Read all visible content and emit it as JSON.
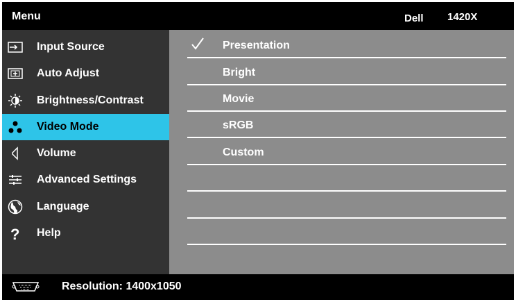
{
  "header": {
    "menu_title": "Menu",
    "brand": "Dell",
    "model": "1420X"
  },
  "sidebar": {
    "items": [
      {
        "label": "Input Source",
        "icon": "input-source-icon"
      },
      {
        "label": "Auto Adjust",
        "icon": "auto-adjust-icon"
      },
      {
        "label": "Brightness/Contrast",
        "icon": "brightness-icon"
      },
      {
        "label": "Video Mode",
        "icon": "video-mode-icon",
        "active": true
      },
      {
        "label": "Volume",
        "icon": "volume-icon"
      },
      {
        "label": "Advanced Settings",
        "icon": "advanced-settings-icon"
      },
      {
        "label": "Language",
        "icon": "globe-icon"
      },
      {
        "label": "Help",
        "icon": "help-icon"
      }
    ]
  },
  "video_modes": {
    "options": [
      {
        "label": "Presentation",
        "selected": true
      },
      {
        "label": "Bright"
      },
      {
        "label": "Movie"
      },
      {
        "label": "sRGB"
      },
      {
        "label": "Custom"
      },
      {
        "label": ""
      },
      {
        "label": ""
      },
      {
        "label": ""
      }
    ]
  },
  "footer": {
    "resolution": "Resolution: 1400x1050",
    "icon": "vga-connector-icon"
  },
  "colors": {
    "active": "#2ec4e8",
    "sidebar": "#333333",
    "content": "#8c8c8c",
    "background": "#000000"
  }
}
